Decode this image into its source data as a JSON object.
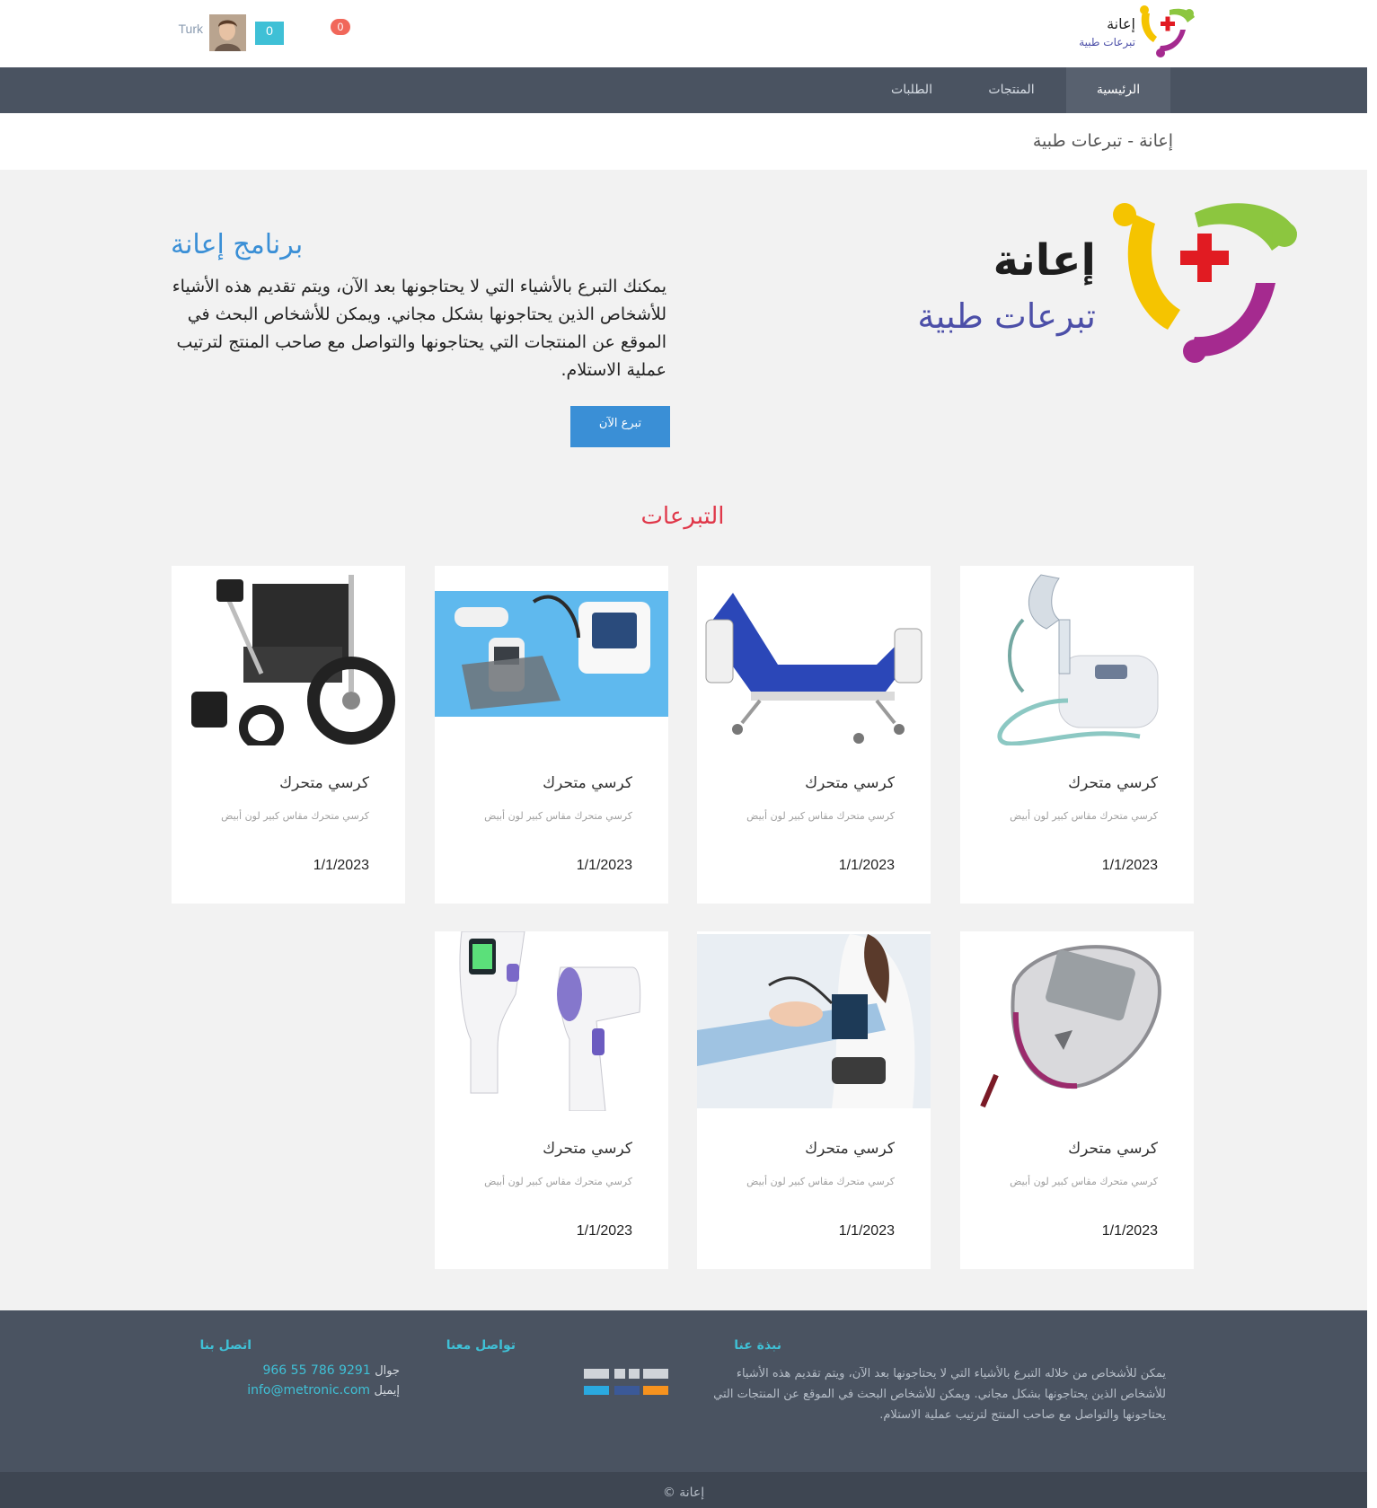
{
  "header": {
    "logo_title": "إعانة",
    "logo_subtitle": "تبرعات طبية",
    "user_name": "Turk",
    "cart_count": "0",
    "notification_count": "0"
  },
  "nav": {
    "items": [
      {
        "label": "الرئيسية",
        "active": true
      },
      {
        "label": "المنتجات",
        "active": false
      },
      {
        "label": "الطلبات",
        "active": false
      }
    ]
  },
  "breadcrumb": "إعانة - تبرعات طبية",
  "hero": {
    "logo_title": "إعانة",
    "logo_subtitle": "تبرعات طبية",
    "title": "برنامج إعانة",
    "text": "يمكنك التبرع بالأشياء التي لا يحتاجونها بعد الآن، ويتم تقديم هذه الأشياء للأشخاص الذين يحتاجونها بشكل مجاني. ويمكن للأشخاص البحث في الموقع عن المنتجات التي يحتاجونها والتواصل مع صاحب المنتج لترتيب عملية الاستلام.",
    "button_label": "تبرع الآن"
  },
  "donations": {
    "title": "التبرعات",
    "cards": [
      {
        "title": "كرسي متحرك",
        "description": "كرسي متحرك مقاس كبير لون أبيض",
        "date": "1/1/2023",
        "image": "nebulizer"
      },
      {
        "title": "كرسي متحرك",
        "description": "كرسي متحرك مقاس كبير لون أبيض",
        "date": "1/1/2023",
        "image": "hospital-bed"
      },
      {
        "title": "كرسي متحرك",
        "description": "كرسي متحرك مقاس كبير لون أبيض",
        "date": "1/1/2023",
        "image": "medical-devices"
      },
      {
        "title": "كرسي متحرك",
        "description": "كرسي متحرك مقاس كبير لون أبيض",
        "date": "1/1/2023",
        "image": "wheelchair"
      },
      {
        "title": "كرسي متحرك",
        "description": "كرسي متحرك مقاس كبير لون أبيض",
        "date": "1/1/2023",
        "image": "glucometer"
      },
      {
        "title": "كرسي متحرك",
        "description": "كرسي متحرك مقاس كبير لون أبيض",
        "date": "1/1/2023",
        "image": "blood-pressure"
      },
      {
        "title": "كرسي متحرك",
        "description": "كرسي متحرك مقاس كبير لون أبيض",
        "date": "1/1/2023",
        "image": "thermometer"
      }
    ]
  },
  "footer": {
    "about_title": "نبذة عنا",
    "about_text": "يمكن للأشخاص من خلاله التبرع بالأشياء التي لا يحتاجونها بعد الآن، ويتم تقديم هذه الأشياء للأشخاص الذين يحتاجونها بشكل مجاني. ويمكن للأشخاص البحث في الموقع عن المنتجات التي يحتاجونها والتواصل مع صاحب المنتج لترتيب عملية الاستلام.",
    "social_title": "تواصل معنا",
    "contact_title": "اتصل بنا",
    "phone_label": "جوال",
    "phone": "966 55 786 9291",
    "email_label": "إيميل",
    "email": "info@metronic.com",
    "copyright": "إعانة ©"
  },
  "colors": {
    "nav_bg": "#4a5361",
    "accent_blue": "#3a8fd6",
    "accent_red": "#e0384a",
    "accent_teal": "#3fc0d6"
  }
}
